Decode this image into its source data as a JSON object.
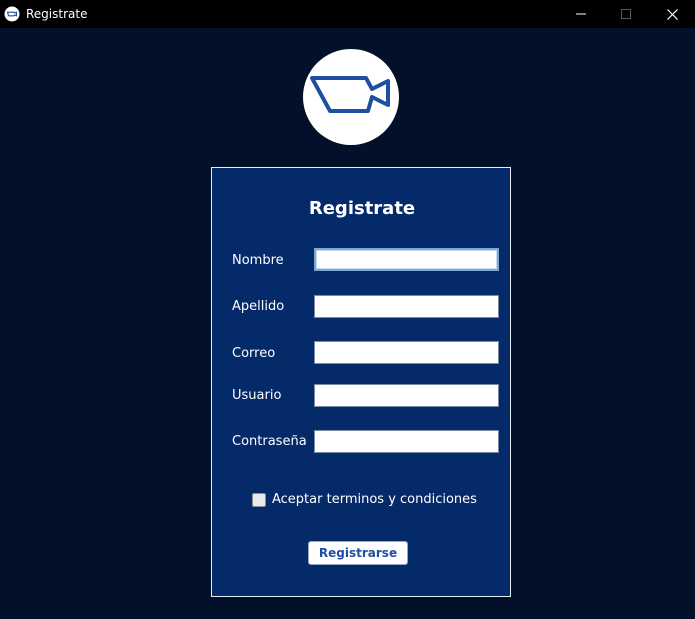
{
  "window": {
    "title": "Registrate",
    "app_icon": "camera-icon",
    "controls": [
      "minimize-icon",
      "maximize-icon",
      "close-icon"
    ]
  },
  "logo": {
    "icon": "video-camera-icon",
    "accent": "#1f4fa0"
  },
  "form": {
    "title": "Registrate",
    "fields": [
      {
        "label": "Nombre",
        "value": "",
        "focused": true
      },
      {
        "label": "Apellido",
        "value": ""
      },
      {
        "label": "Correo",
        "value": ""
      },
      {
        "label": "Usuario",
        "value": ""
      },
      {
        "label": "Contraseña",
        "value": ""
      }
    ],
    "terms": {
      "label": "Aceptar terminos y condiciones",
      "checked": false
    },
    "submit_label": "Registrarse"
  },
  "colors": {
    "background": "#02102a",
    "panel": "#052a6a",
    "titlebar": "#000000",
    "button_text": "#1f4fa0"
  }
}
